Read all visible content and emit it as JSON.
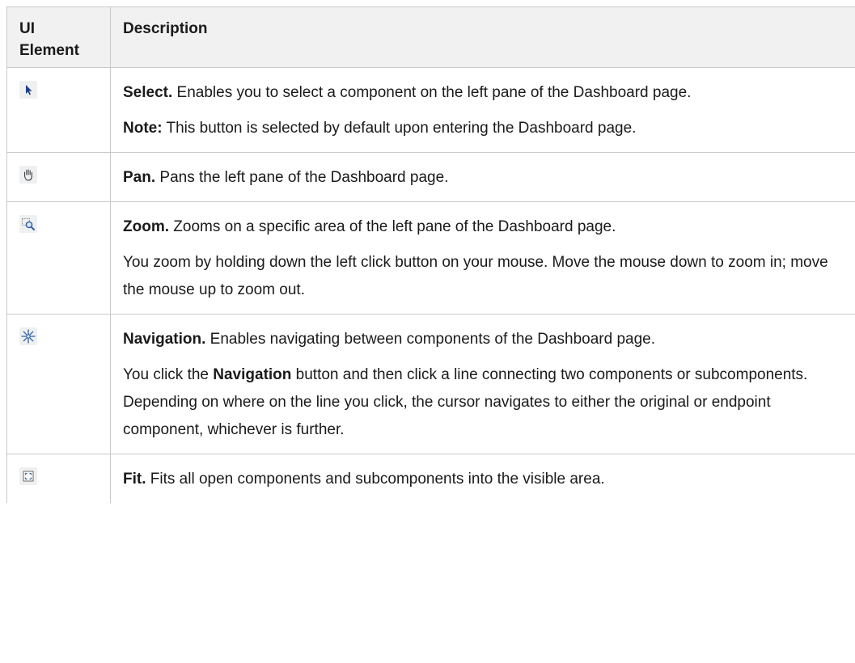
{
  "header": {
    "col1_line1": "UI",
    "col1_line2": "Element",
    "col2": "Description"
  },
  "rows": [
    {
      "icon": "select-cursor-icon",
      "title": "Select.",
      "text": " Enables you to select a component on the left pane of the Dashboard page.",
      "note_label": "Note:",
      "note_text": " This button is selected by default upon entering the Dashboard page."
    },
    {
      "icon": "pan-hand-icon",
      "title": "Pan.",
      "text": " Pans the left pane of the Dashboard page."
    },
    {
      "icon": "zoom-icon",
      "title": "Zoom.",
      "text": " Zooms on a specific area of the left pane of the Dashboard page.",
      "extra": "You zoom by holding down the left click button on your mouse. Move the mouse down to zoom in; move the mouse up to zoom out."
    },
    {
      "icon": "navigation-icon",
      "title": "Navigation.",
      "text": " Enables navigating between components of the Dashboard page.",
      "extra_pre": "You click the ",
      "extra_bold": "Navigation",
      "extra_post": " button and then click a line connecting two components or subcomponents. Depending on where on the line you click, the cursor navigates to either the original or endpoint component, whichever is further."
    },
    {
      "icon": "fit-icon",
      "title": "Fit.",
      "text": " Fits all open components and subcomponents into the visible area."
    }
  ]
}
